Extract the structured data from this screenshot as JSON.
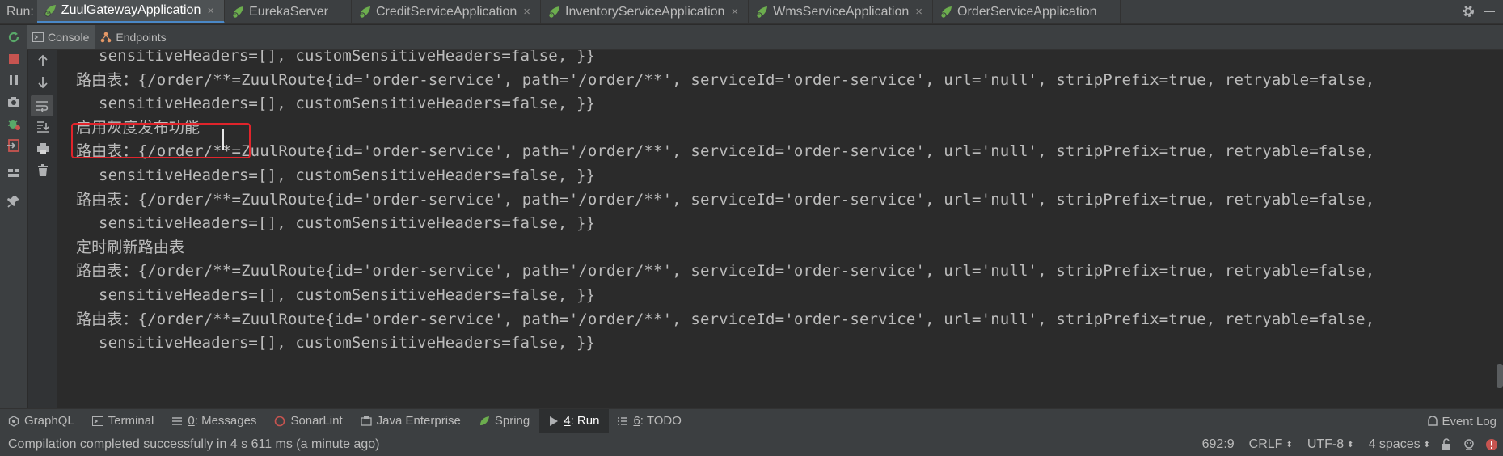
{
  "run_panel": {
    "label": "Run:",
    "tabs": [
      {
        "label": "ZuulGatewayApplication",
        "active": true,
        "closable": true
      },
      {
        "label": "EurekaServer",
        "active": false,
        "closable": false
      },
      {
        "label": "CreditServiceApplication",
        "active": false,
        "closable": true
      },
      {
        "label": "InventoryServiceApplication",
        "active": false,
        "closable": true
      },
      {
        "label": "WmsServiceApplication",
        "active": false,
        "closable": true
      },
      {
        "label": "OrderServiceApplication",
        "active": false,
        "closable": false
      }
    ],
    "close_glyph": "×"
  },
  "subtabs": {
    "console": "Console",
    "endpoints": "Endpoints"
  },
  "console": {
    "lines": [
      {
        "text": "sensitiveHeaders=[], customSensitiveHeaders=false, }}",
        "cont": true
      },
      {
        "text": "路由表：{/order/**=ZuulRoute{id='order-service', path='/order/**', serviceId='order-service', url='null', stripPrefix=true, retryable=false,",
        "cont": false
      },
      {
        "text": "sensitiveHeaders=[], customSensitiveHeaders=false, }}",
        "cont": true
      },
      {
        "text": "启用灰度发布功能",
        "cont": false
      },
      {
        "text": "路由表：{/order/**=ZuulRoute{id='order-service', path='/order/**', serviceId='order-service', url='null', stripPrefix=true, retryable=false,",
        "cont": false
      },
      {
        "text": "sensitiveHeaders=[], customSensitiveHeaders=false, }}",
        "cont": true
      },
      {
        "text": "路由表：{/order/**=ZuulRoute{id='order-service', path='/order/**', serviceId='order-service', url='null', stripPrefix=true, retryable=false,",
        "cont": false
      },
      {
        "text": "sensitiveHeaders=[], customSensitiveHeaders=false, }}",
        "cont": true
      },
      {
        "text": "定时刷新路由表",
        "cont": false
      },
      {
        "text": "路由表：{/order/**=ZuulRoute{id='order-service', path='/order/**', serviceId='order-service', url='null', stripPrefix=true, retryable=false,",
        "cont": false
      },
      {
        "text": "sensitiveHeaders=[], customSensitiveHeaders=false, }}",
        "cont": true
      },
      {
        "text": "路由表：{/order/**=ZuulRoute{id='order-service', path='/order/**', serviceId='order-service', url='null', stripPrefix=true, retryable=false,",
        "cont": false
      },
      {
        "text": "sensitiveHeaders=[], customSensitiveHeaders=false, }}",
        "cont": true
      }
    ]
  },
  "tool_windows": {
    "graphql": "GraphQL",
    "terminal": "Terminal",
    "messages_num": "0",
    "messages": ": Messages",
    "sonarlint": "SonarLint",
    "java_enterprise": "Java Enterprise",
    "spring": "Spring",
    "run_num": "4",
    "run": ": Run",
    "todo_num": "6",
    "todo": ": TODO",
    "event_log": "Event Log"
  },
  "status_bar": {
    "message": "Compilation completed successfully in 4 s 611 ms (a minute ago)",
    "position": "692:9",
    "line_sep": "CRLF",
    "encoding": "UTF-8",
    "indent": "4 spaces"
  },
  "colors": {
    "accent": "#4a88c7",
    "highlight_box": "#e0242b",
    "spring_green": "#6cad4e",
    "stop_red": "#c75450"
  }
}
